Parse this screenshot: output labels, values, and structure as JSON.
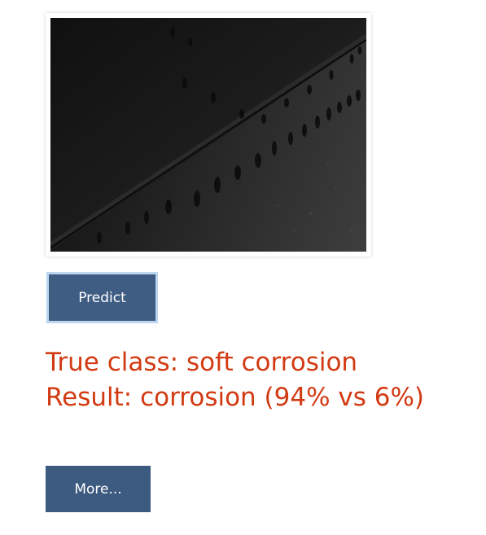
{
  "image": {
    "icon": "corrosion-sample-photo"
  },
  "predict_button": {
    "label": "Predict"
  },
  "result": {
    "true_class": "True class: soft corrosion",
    "prediction": "Result: corrosion (94% vs 6%)"
  },
  "more_button": {
    "label": "More..."
  },
  "colors": {
    "button_bg": "#3f5d83",
    "button_focus_ring": "#bcd6f0",
    "result_text": "#d23a12"
  }
}
